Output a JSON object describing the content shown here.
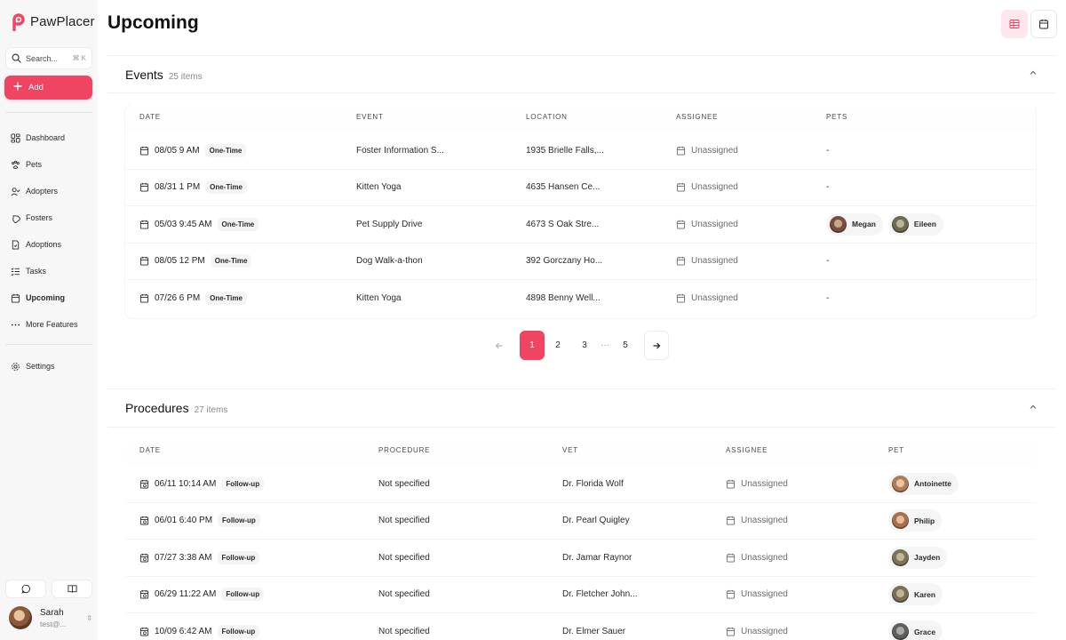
{
  "app": {
    "name": "PawPlacer"
  },
  "search": {
    "label": "Search...",
    "shortcut": "⌘ K"
  },
  "add": {
    "label": "Add"
  },
  "nav": [
    {
      "label": "Dashboard",
      "icon": "dashboard-icon"
    },
    {
      "label": "Pets",
      "icon": "paw-icon"
    },
    {
      "label": "Adopters",
      "icon": "user-check-icon"
    },
    {
      "label": "Fosters",
      "icon": "home-heart-icon"
    },
    {
      "label": "Adoptions",
      "icon": "file-icon"
    },
    {
      "label": "Tasks",
      "icon": "checklist-icon"
    },
    {
      "label": "Upcoming",
      "icon": "calendar-icon"
    },
    {
      "label": "More Features",
      "icon": "more-icon"
    }
  ],
  "settings": {
    "label": "Settings"
  },
  "user": {
    "name": "Sarah",
    "email": "test@..."
  },
  "page": {
    "title": "Upcoming"
  },
  "events": {
    "title": "Events",
    "count": "25 items",
    "columns": [
      "DATE",
      "EVENT",
      "LOCATION",
      "ASSIGNEE",
      "PETS"
    ],
    "rows": [
      {
        "date": "08/05 9 AM",
        "type": "One-Time",
        "event": "Foster Information S...",
        "location": "1935 Brielle Falls,...",
        "assignee": "Unassigned",
        "pets": "-"
      },
      {
        "date": "08/31 1 PM",
        "type": "One-Time",
        "event": "Kitten Yoga",
        "location": "4635 Hansen Ce...",
        "assignee": "Unassigned",
        "pets": "-"
      },
      {
        "date": "05/03 9:45 AM",
        "type": "One-Time",
        "event": "Pet Supply Drive",
        "location": "4673 S Oak Stre...",
        "assignee": "Unassigned",
        "pets": "",
        "pet_pills": [
          "Megan",
          "Eileen"
        ]
      },
      {
        "date": "08/05 12 PM",
        "type": "One-Time",
        "event": "Dog Walk-a-thon",
        "location": "392 Gorczany Ho...",
        "assignee": "Unassigned",
        "pets": "-"
      },
      {
        "date": "07/26 6 PM",
        "type": "One-Time",
        "event": "Kitten Yoga",
        "location": "4898 Benny Well...",
        "assignee": "Unassigned",
        "pets": "-"
      }
    ],
    "pagination": {
      "pages": [
        "1",
        "2",
        "3",
        "5"
      ],
      "ellipsis": "···",
      "current": "1"
    }
  },
  "procedures": {
    "title": "Procedures",
    "count": "27 items",
    "columns": [
      "DATE",
      "PROCEDURE",
      "VET",
      "ASSIGNEE",
      "PET"
    ],
    "rows": [
      {
        "date": "06/11 10:14 AM",
        "type": "Follow-up",
        "procedure": "Not specified",
        "vet": "Dr. Florida Wolf",
        "assignee": "Unassigned",
        "pet": "Antoinette"
      },
      {
        "date": "06/01 6:40 PM",
        "type": "Follow-up",
        "procedure": "Not specified",
        "vet": "Dr. Pearl Quigley",
        "assignee": "Unassigned",
        "pet": "Philip"
      },
      {
        "date": "07/27 3:38 AM",
        "type": "Follow-up",
        "procedure": "Not specified",
        "vet": "Dr. Jamar Raynor",
        "assignee": "Unassigned",
        "pet": "Jayden"
      },
      {
        "date": "06/29 11:22 AM",
        "type": "Follow-up",
        "procedure": "Not specified",
        "vet": "Dr. Fletcher John...",
        "assignee": "Unassigned",
        "pet": "Karen"
      },
      {
        "date": "10/09 6:42 AM",
        "type": "Follow-up",
        "procedure": "Not specified",
        "vet": "Dr. Elmer Sauer",
        "assignee": "Unassigned",
        "pet": "Grace"
      }
    ]
  },
  "colors": {
    "accent": "#f04463",
    "accent_soft": "#fde7ec"
  }
}
